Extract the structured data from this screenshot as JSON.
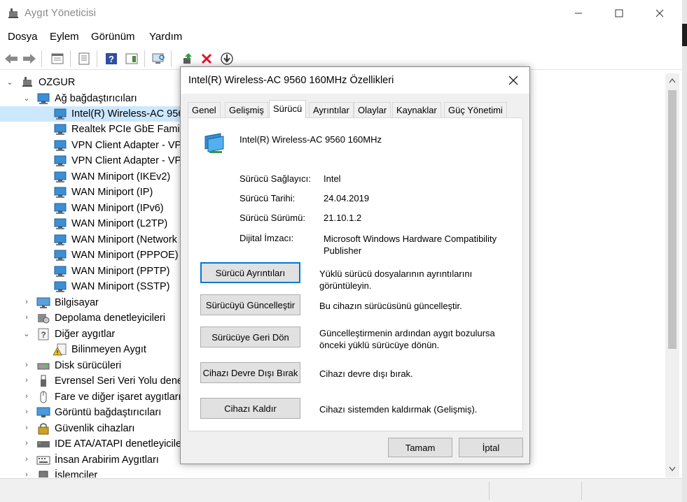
{
  "window": {
    "title": "Aygıt Yöneticisi"
  },
  "menu": [
    "Dosya",
    "Eylem",
    "Görünüm",
    "Yardım"
  ],
  "toolbar_icons": [
    "back-arrow-icon",
    "forward-arrow-icon",
    "properties-view-icon",
    "show-hidden-icon",
    "help-icon",
    "action-pane-icon",
    "scan-hardware-icon",
    "update-driver-icon",
    "uninstall-icon",
    "disable-device-icon"
  ],
  "tree": {
    "root": "OZGUR",
    "network": {
      "label": "Ağ bağdaştırıcıları",
      "children": [
        "Intel(R) Wireless-AC 9560",
        "Realtek PCIe GbE Family",
        "VPN Client Adapter - VP",
        "VPN Client Adapter - VP",
        "WAN Miniport (IKEv2)",
        "WAN Miniport (IP)",
        "WAN Miniport (IPv6)",
        "WAN Miniport (L2TP)",
        "WAN Miniport (Network",
        "WAN Miniport (PPPOE)",
        "WAN Miniport (PPTP)",
        "WAN Miniport (SSTP)"
      ]
    },
    "computer": "Bilgisayar",
    "storage": "Depolama denetleyicileri",
    "other": {
      "label": "Diğer aygıtlar",
      "children": [
        "Bilinmeyen Aygıt"
      ]
    },
    "categories": [
      "Disk sürücüleri",
      "Evrensel Seri Veri Yolu denet",
      "Fare ve diğer işaret aygıtları",
      "Görüntü bağdaştırıcıları",
      "Güvenlik cihazları",
      "IDE ATA/ATAPI denetleyiciler",
      "İnsan Arabirim Aygıtları",
      "İşlemciler"
    ]
  },
  "dialog": {
    "title": "Intel(R) Wireless-AC 9560 160MHz Özellikleri",
    "tabs": [
      "Genel",
      "Gelişmiş",
      "Sürücü",
      "Ayrıntılar",
      "Olaylar",
      "Kaynaklar",
      "Güç Yönetimi"
    ],
    "active_tab": "Sürücü",
    "device_name": "Intel(R) Wireless-AC 9560 160MHz",
    "props": {
      "provider_label": "Sürücü Sağlayıcı:",
      "provider_value": "Intel",
      "date_label": "Sürücü Tarihi:",
      "date_value": "24.04.2019",
      "version_label": "Sürücü Sürümü:",
      "version_value": "21.10.1.2",
      "signer_label": "Dijital İmzacı:",
      "signer_value": "Microsoft Windows Hardware Compatibility Publisher"
    },
    "actions": {
      "details_btn": "Sürücü Ayrıntıları",
      "details_desc": "Yüklü sürücü dosyalarının ayrıntılarını görüntüleyin.",
      "update_btn": "Sürücüyü Güncelleştir",
      "update_desc": "Bu cihazın sürücüsünü güncelleştir.",
      "rollback_btn": "Sürücüye Geri Dön",
      "rollback_desc": "Güncelleştirmenin ardından aygıt bozulursa önceki yüklü sürücüye dönün.",
      "disable_btn": "Cihazı Devre Dışı Bırak",
      "disable_desc": "Cihazı devre dışı bırak.",
      "uninstall_btn": "Cihazı Kaldır",
      "uninstall_desc": "Cihazı sistemden kaldırmak (Gelişmiş)."
    },
    "ok": "Tamam",
    "cancel": "İptal"
  },
  "colors": {
    "selection": "#cce8ff",
    "accent": "#0078d7",
    "error_red": "#e81123"
  }
}
